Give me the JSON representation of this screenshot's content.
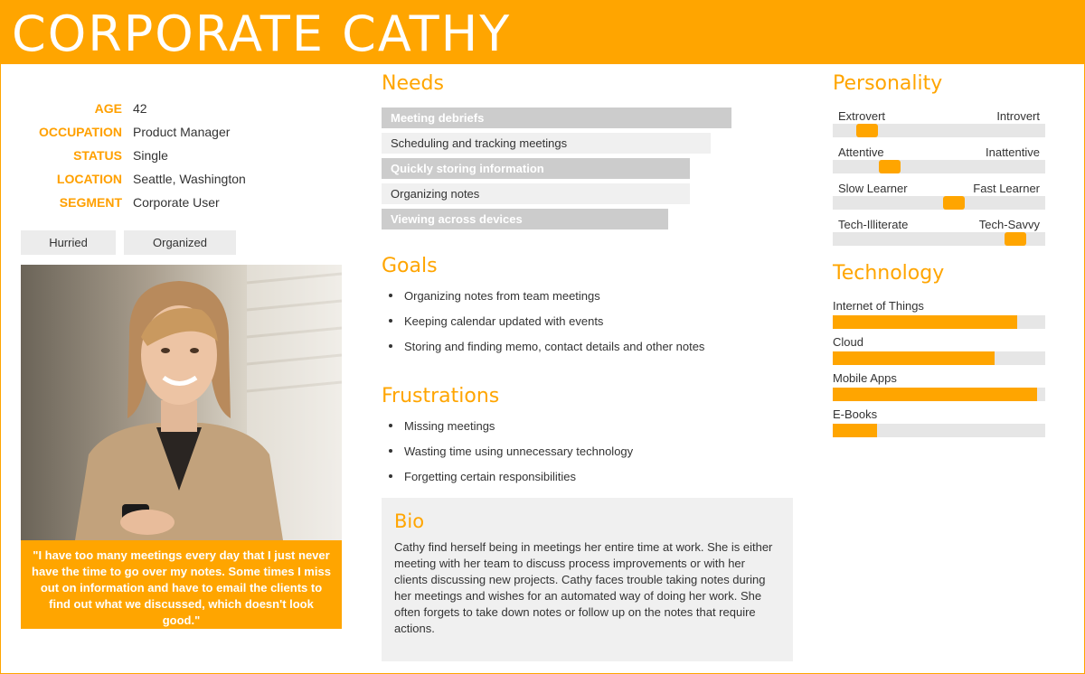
{
  "header": {
    "title": "CORPORATE CATHY"
  },
  "info": [
    {
      "label": "AGE",
      "value": "42"
    },
    {
      "label": "OCCUPATION",
      "value": "Product Manager"
    },
    {
      "label": "STATUS",
      "value": "Single"
    },
    {
      "label": "LOCATION",
      "value": "Seattle, Washington"
    },
    {
      "label": "SEGMENT",
      "value": "Corporate User"
    }
  ],
  "tags": [
    "Hurried",
    "Organized"
  ],
  "quote": "\"I have too many meetings every day that I just never have the time to go over my notes. Some times I miss out on information and have to email the clients to find out what we discussed, which doesn't look good.\"",
  "needs": {
    "title": "Needs",
    "items": [
      {
        "label": "Meeting debriefs",
        "level": 100
      },
      {
        "label": "Scheduling and tracking meetings",
        "level": 94
      },
      {
        "label": "Quickly storing information",
        "level": 88
      },
      {
        "label": "Organizing notes",
        "level": 88
      },
      {
        "label": "Viewing across devices",
        "level": 82
      }
    ]
  },
  "goals": {
    "title": "Goals",
    "items": [
      "Organizing notes from team meetings",
      "Keeping calendar updated with events",
      "Storing and finding memo, contact details and other notes"
    ]
  },
  "frustrations": {
    "title": "Frustrations",
    "items": [
      "Missing meetings",
      "Wasting time using unnecessary technology",
      "Forgetting certain responsibilities"
    ]
  },
  "bio": {
    "title": "Bio",
    "text": "Cathy find herself being in meetings her entire time at work. She is either meeting with her team to discuss process improvements or with her clients discussing new projects. Cathy faces trouble taking notes during her meetings and wishes for an automated way of doing her work. She often forgets to take down notes or follow up on the notes that require actions."
  },
  "personality": {
    "title": "Personality",
    "traits": [
      {
        "left": "Extrovert",
        "right": "Introvert",
        "value": 0.16
      },
      {
        "left": "Attentive",
        "right": "Inattentive",
        "value": 0.27
      },
      {
        "left": "Slow Learner",
        "right": "Fast Learner",
        "value": 0.57
      },
      {
        "left": "Tech-Illiterate",
        "right": "Tech-Savvy",
        "value": 0.86
      }
    ]
  },
  "technology": {
    "title": "Technology",
    "items": [
      {
        "label": "Internet of Things",
        "value": 0.87
      },
      {
        "label": "Cloud",
        "value": 0.76
      },
      {
        "label": "Mobile Apps",
        "value": 0.96
      },
      {
        "label": "E-Books",
        "value": 0.21
      }
    ]
  },
  "colors": {
    "accent": "#ffa500",
    "bar_dark": "#cccccc",
    "bar_light": "#f0f0f0",
    "track": "#e6e6e6"
  }
}
